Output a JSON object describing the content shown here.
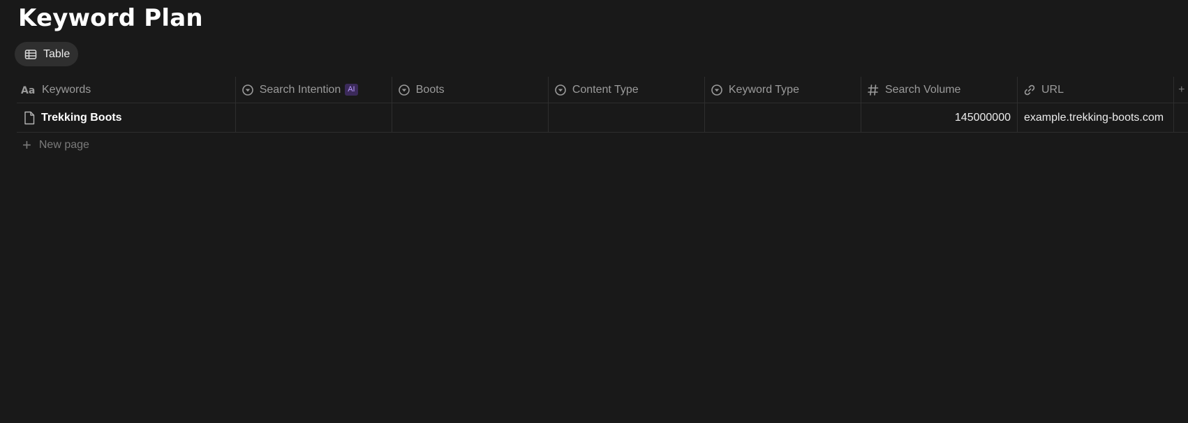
{
  "page": {
    "title": "Keyword Plan"
  },
  "views": {
    "active_label": "Table",
    "active_icon": "table-icon"
  },
  "table": {
    "columns": [
      {
        "label": "Keywords",
        "icon": "text-property-icon"
      },
      {
        "label": "Search Intention",
        "icon": "select-property-icon",
        "badge": "AI"
      },
      {
        "label": "Boots",
        "icon": "select-property-icon"
      },
      {
        "label": "Content Type",
        "icon": "select-property-icon"
      },
      {
        "label": "Keyword Type",
        "icon": "select-property-icon"
      },
      {
        "label": "Search Volume",
        "icon": "number-property-icon"
      },
      {
        "label": "URL",
        "icon": "link-property-icon"
      }
    ],
    "rows": [
      {
        "keywords": "Trekking Boots",
        "search_intention": "",
        "boots": "",
        "content_type": "",
        "keyword_type": "",
        "search_volume": "145000000",
        "url": "example.trekking-boots.com"
      }
    ],
    "new_page_label": "New page"
  },
  "colors": {
    "background": "#191919",
    "text": "#d4d4d4",
    "muted": "#9b9b9b",
    "ai_badge_bg": "#3b2a5a",
    "ai_badge_text": "#b99aff"
  }
}
